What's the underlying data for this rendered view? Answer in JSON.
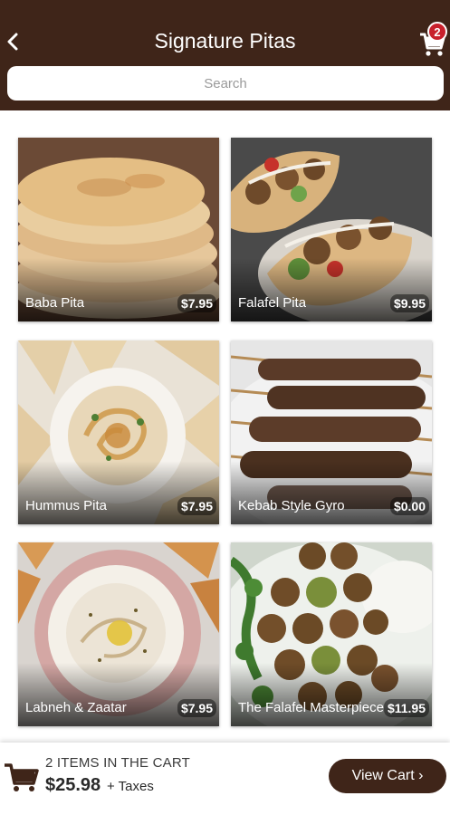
{
  "header": {
    "title": "Signature Pitas",
    "cart_badge": "2",
    "search_placeholder": "Search"
  },
  "items": [
    {
      "name": "Baba Pita",
      "price": "$7.95"
    },
    {
      "name": "Falafel Pita",
      "price": "$9.95"
    },
    {
      "name": "Hummus Pita",
      "price": "$7.95"
    },
    {
      "name": "Kebab Style Gyro",
      "price": "$0.00"
    },
    {
      "name": "Labneh & Zaatar",
      "price": "$7.95"
    },
    {
      "name": "The Falafel Masterpiece",
      "price": "$11.95"
    }
  ],
  "footer": {
    "items_in_cart": "2 ITEMS IN THE CART",
    "total": "$25.98",
    "taxes": "+ Taxes",
    "view_cart_label": "View Cart ›"
  },
  "colors": {
    "header_bg": "#3f2519",
    "badge": "#c8202c",
    "button": "#3f2519"
  }
}
